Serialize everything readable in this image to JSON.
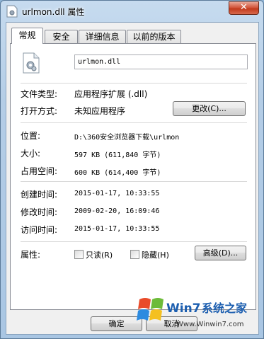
{
  "window": {
    "title": "urlmon.dll 属性",
    "close_label": "✕"
  },
  "tabs": [
    {
      "label": "常规"
    },
    {
      "label": "安全"
    },
    {
      "label": "详细信息"
    },
    {
      "label": "以前的版本"
    }
  ],
  "general": {
    "file_name": "urlmon.dll",
    "type_label": "文件类型:",
    "type_value": "应用程序扩展 (.dll)",
    "open_label": "打开方式:",
    "open_value": "未知应用程序",
    "change_button": "更改(C)...",
    "location_label": "位置:",
    "location_value": "D:\\360安全浏览器下载\\urlmon",
    "size_label": "大小:",
    "size_value": "597 KB (611,840 字节)",
    "disk_label": "占用空间:",
    "disk_value": "600 KB (614,400 字节)",
    "created_label": "创建时间:",
    "created_value": "2015-01-17, 10:33:55",
    "modified_label": "修改时间:",
    "modified_value": "2009-02-20, 16:09:46",
    "accessed_label": "访问时间:",
    "accessed_value": "2015-01-17, 10:33:55",
    "attr_label": "属性:",
    "readonly_label": "只读(R)",
    "hidden_label": "隐藏(H)",
    "advanced_button": "高级(D)..."
  },
  "footer": {
    "ok_button": "确定",
    "cancel_button": "取消"
  },
  "watermark": {
    "brand": "Win7",
    "site_cn": "系统之家",
    "url": "Www.Winwin7.com"
  }
}
